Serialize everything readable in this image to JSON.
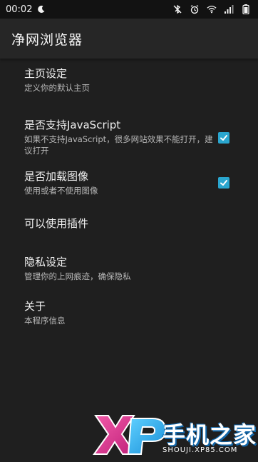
{
  "status_bar": {
    "time": "00:02",
    "icons": [
      "moon-icon",
      "bluetooth-off-icon",
      "alarm-icon",
      "wifi-icon",
      "signal-icon",
      "battery-icon"
    ]
  },
  "app": {
    "title": "净网浏览器"
  },
  "settings": [
    {
      "title": "主页设定",
      "description": "定义你的默认主页"
    },
    {
      "title": "是否支持JavaScript",
      "description": "如果不支持JavaScript，很多网站效果不能打开，建议打开",
      "checked": true
    },
    {
      "title": "是否加载图像",
      "description": "使用或者不使用图像",
      "checked": true
    },
    {
      "title": "可以使用插件"
    },
    {
      "title": "隐私设定",
      "description": "管理你的上网痕迹，确保隐私"
    },
    {
      "title": "关于",
      "description": "本程序信息"
    }
  ],
  "watermark": {
    "brand": "XP",
    "text": "手机之家",
    "url": "SHOUJI.XP85.COM"
  },
  "colors": {
    "accent": "#2aa6cf",
    "background": "#1f1f1f",
    "appbar": "#262626"
  }
}
